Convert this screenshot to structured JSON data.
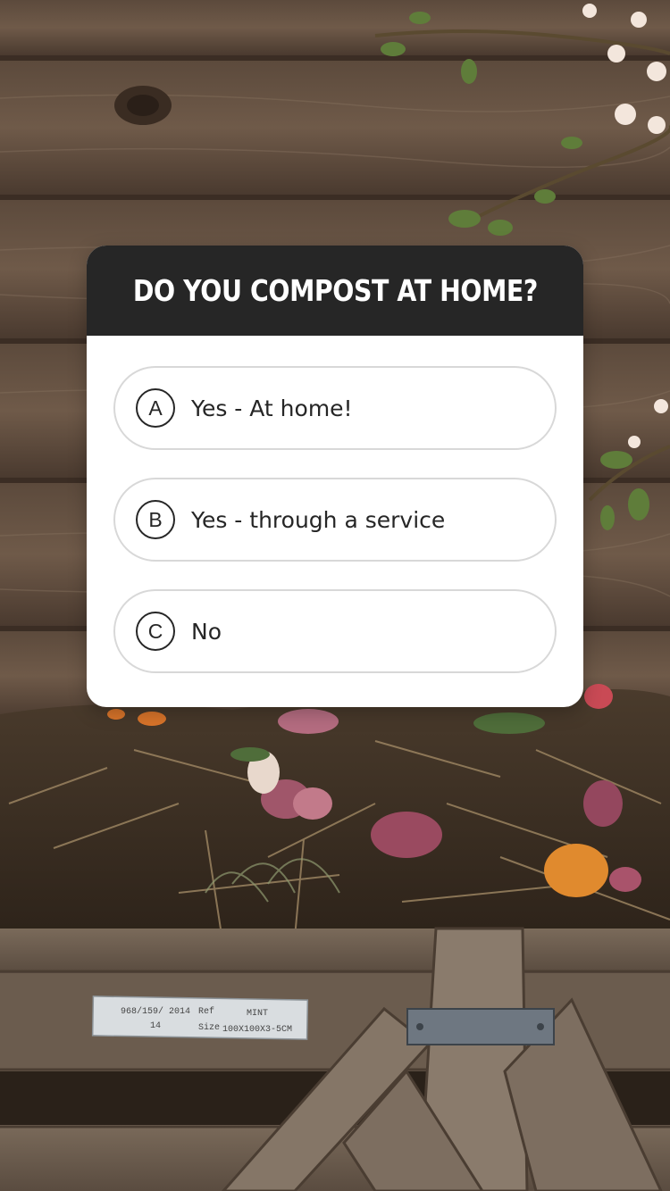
{
  "quiz": {
    "question": "DO YOU COMPOST AT HOME?",
    "options": [
      {
        "letter": "A",
        "label": "Yes - At home!"
      },
      {
        "letter": "B",
        "label": "Yes - through a service"
      },
      {
        "letter": "C",
        "label": "No"
      }
    ]
  },
  "photo": {
    "tag_line1_a": "968/159/ 2014",
    "tag_line1_b": "Ref",
    "tag_line1_c": "MINT",
    "tag_line2_a": "14",
    "tag_line2_b": "Size",
    "tag_line2_c": "100X100X3-5CM"
  },
  "colors": {
    "header_bg": "#262626",
    "card_bg": "#ffffff",
    "option_border": "#d8d8d8"
  }
}
